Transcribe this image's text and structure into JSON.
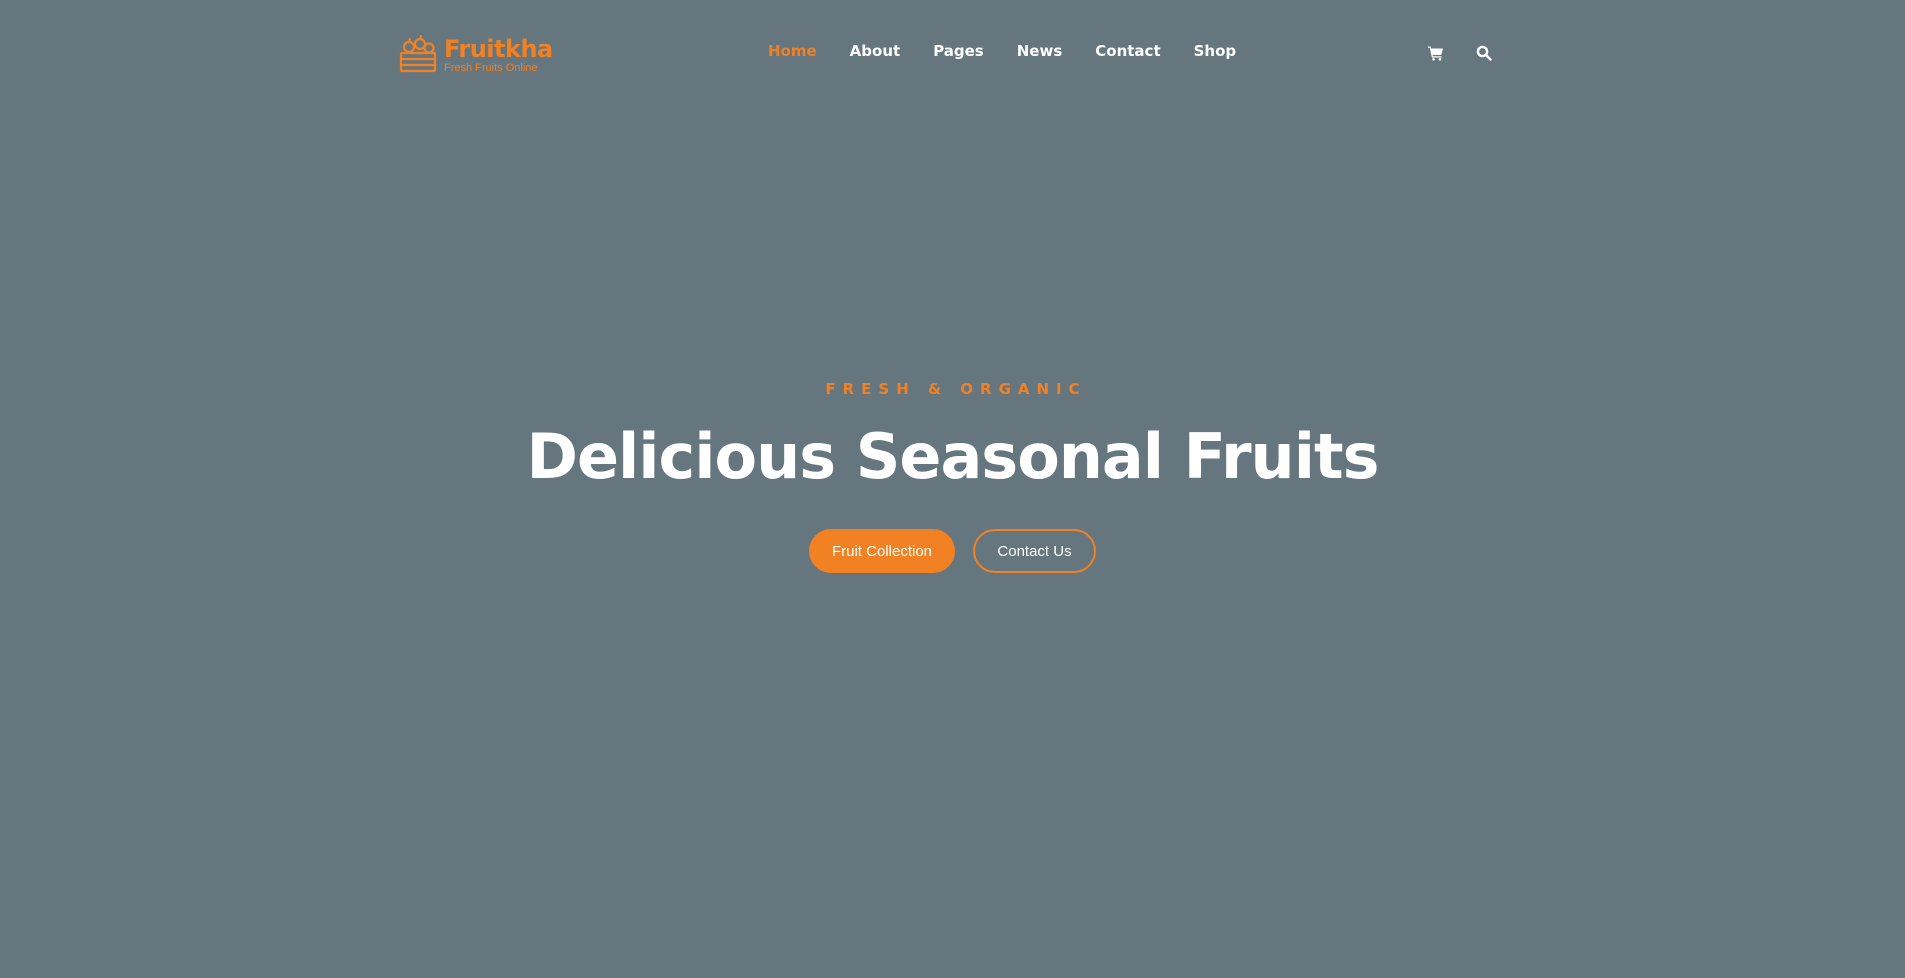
{
  "brand": {
    "name": "Fruitkha",
    "tagline": "Fresh Fruits Online",
    "logo_icon": "fruit-basket-icon",
    "accent_color": "#f28123"
  },
  "nav": {
    "items": [
      {
        "label": "Home",
        "active": true
      },
      {
        "label": "About",
        "active": false
      },
      {
        "label": "Pages",
        "active": false
      },
      {
        "label": "News",
        "active": false
      },
      {
        "label": "Contact",
        "active": false
      },
      {
        "label": "Shop",
        "active": false
      }
    ]
  },
  "header_icons": {
    "cart": "shopping-cart-icon",
    "search": "search-icon"
  },
  "hero": {
    "subtitle": "FRESH & ORGANIC",
    "title": "Delicious Seasonal Fruits",
    "primary_button": "Fruit Collection",
    "secondary_button": "Contact Us",
    "background_color": "#66767f"
  }
}
